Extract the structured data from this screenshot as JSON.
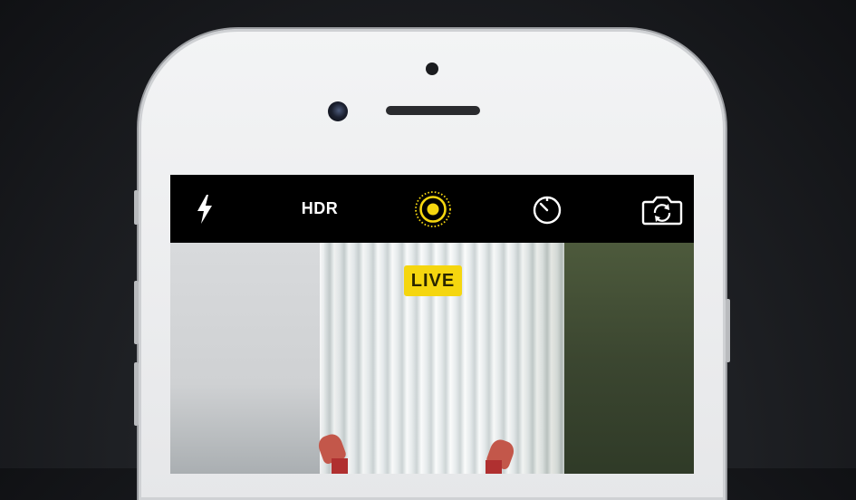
{
  "camera_top_bar": {
    "flash_icon": "lightning-bolt",
    "hdr_label": "HDR",
    "live_photo_icon": "concentric-circles",
    "timer_icon": "stopwatch",
    "flip_camera_icon": "camera-rotate"
  },
  "viewfinder": {
    "live_badge": "LIVE"
  },
  "colors": {
    "live_accent": "#f5d60f",
    "bar_background": "#000000",
    "phone_body": "#eeeff0"
  }
}
